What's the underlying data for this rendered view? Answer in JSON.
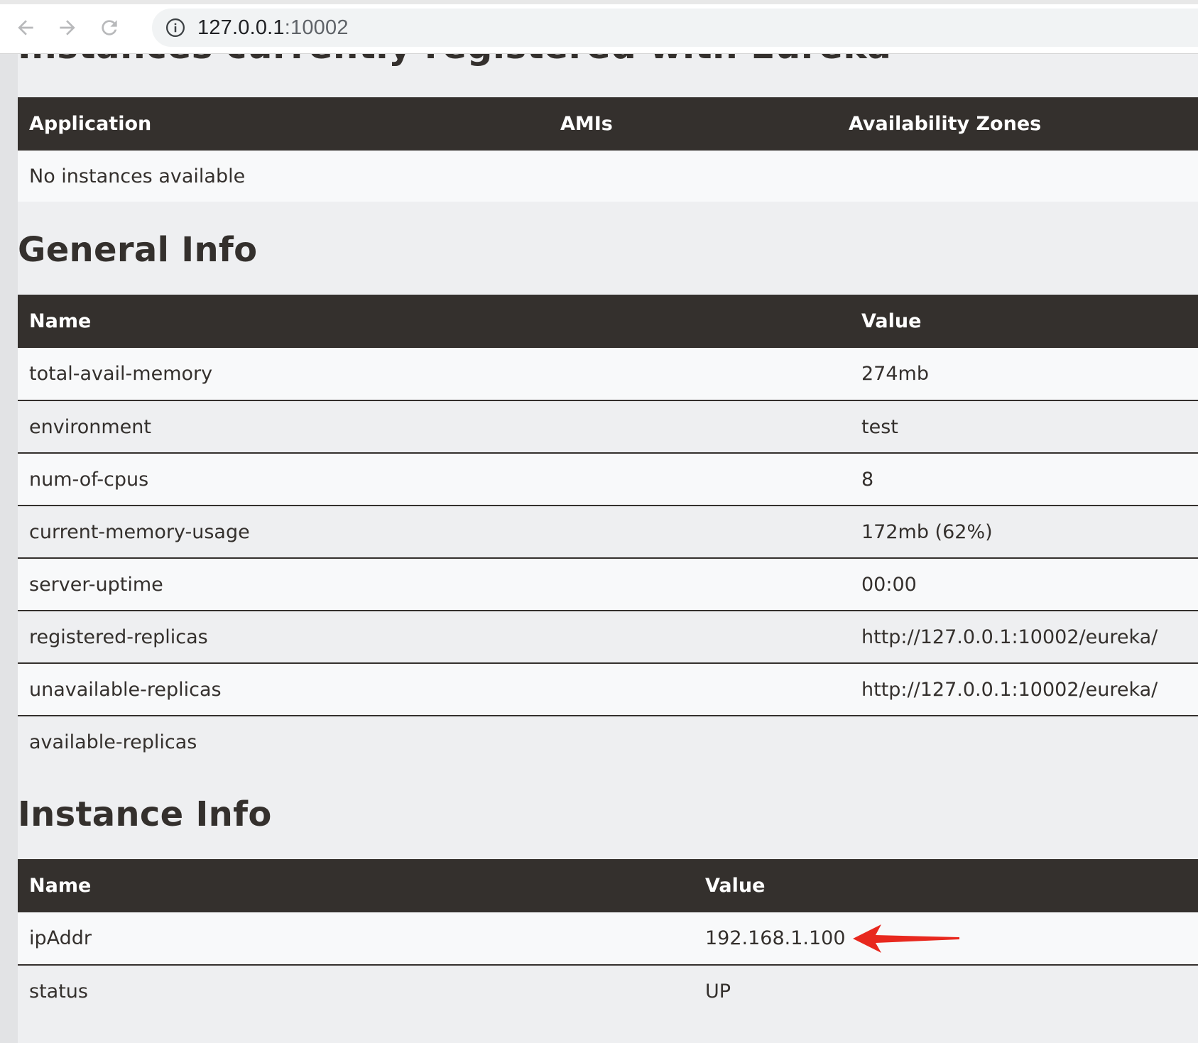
{
  "browser": {
    "url_host": "127.0.0.1",
    "url_port": ":10002",
    "back_icon": "arrow-left-icon",
    "forward_icon": "arrow-right-icon",
    "reload_icon": "reload-icon",
    "info_icon": "info-icon"
  },
  "instances": {
    "title": "Instances currently registered with Eureka",
    "columns": [
      "Application",
      "AMIs",
      "Availability Zones"
    ],
    "empty_text": "No instances available"
  },
  "general_info": {
    "title": "General Info",
    "columns": [
      "Name",
      "Value"
    ],
    "rows": [
      [
        "total-avail-memory",
        "274mb"
      ],
      [
        "environment",
        "test"
      ],
      [
        "num-of-cpus",
        "8"
      ],
      [
        "current-memory-usage",
        "172mb (62%)"
      ],
      [
        "server-uptime",
        "00:00"
      ],
      [
        "registered-replicas",
        "http://127.0.0.1:10002/eureka/"
      ],
      [
        "unavailable-replicas",
        "http://127.0.0.1:10002/eureka/"
      ],
      [
        "available-replicas",
        ""
      ]
    ]
  },
  "instance_info": {
    "title": "Instance Info",
    "columns": [
      "Name",
      "Value"
    ],
    "rows": [
      [
        "ipAddr",
        "192.168.1.100"
      ],
      [
        "status",
        "UP"
      ]
    ]
  },
  "annotation": {
    "arrow_color": "#e8281e",
    "arrow_icon": "red-arrow-icon"
  }
}
